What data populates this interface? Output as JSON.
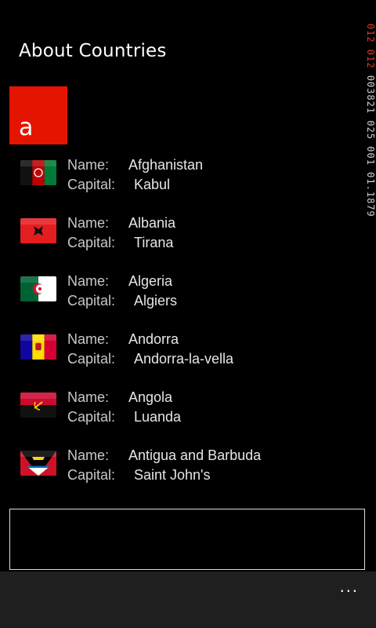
{
  "page": {
    "title": "About Countries"
  },
  "group": {
    "letter": "a",
    "color": "#e51400"
  },
  "labels": {
    "name": "Name:",
    "capital": "Capital:"
  },
  "countries": [
    {
      "name": "Afghanistan",
      "capital": "Kabul",
      "flag": "afghanistan-flag-icon"
    },
    {
      "name": "Albania",
      "capital": "Tirana",
      "flag": "albania-flag-icon"
    },
    {
      "name": "Algeria",
      "capital": "Algiers",
      "flag": "algeria-flag-icon"
    },
    {
      "name": "Andorra",
      "capital": "Andorra-la-vella",
      "flag": "andorra-flag-icon"
    },
    {
      "name": "Angola",
      "capital": "Luanda",
      "flag": "angola-flag-icon"
    },
    {
      "name": "Antigua and Barbuda",
      "capital": "Saint John's",
      "flag": "antigua-flag-icon"
    }
  ],
  "side_readout": {
    "red": "012 012",
    "white": "003821 025 001 01.1879"
  },
  "appbar": {
    "more_label": "..."
  }
}
